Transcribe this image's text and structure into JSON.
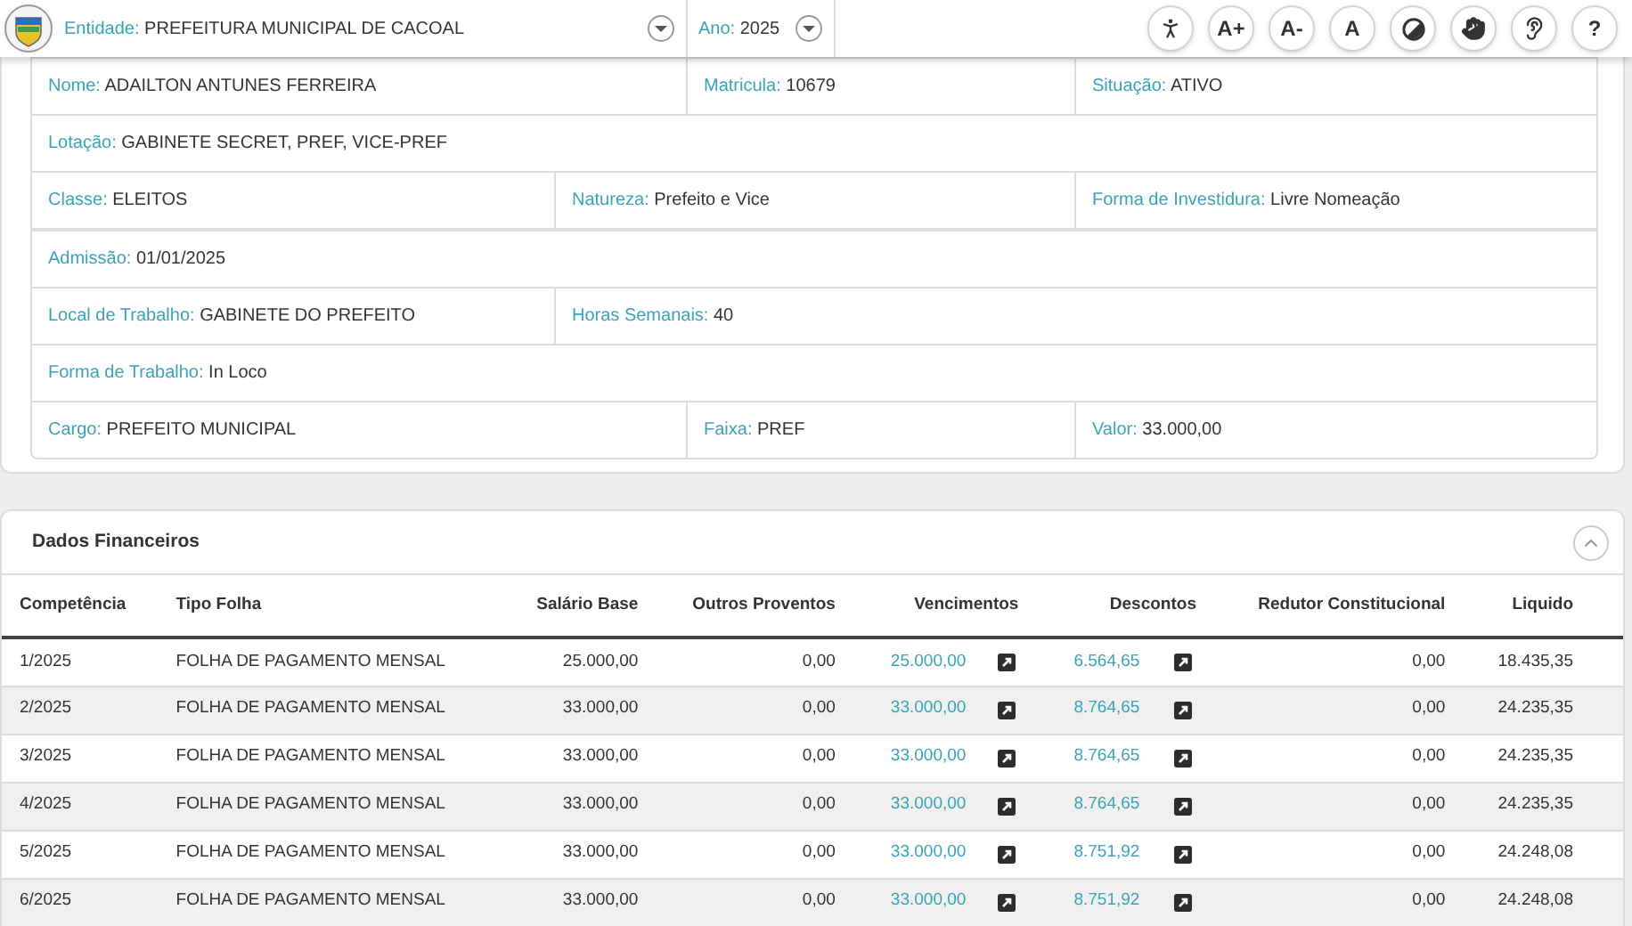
{
  "header": {
    "entity": {
      "label": "Entidade:",
      "value": "PREFEITURA MUNICIPAL DE CACOAL"
    },
    "year": {
      "label": "Ano:",
      "value": "2025"
    },
    "tools": [
      {
        "kind": "accessibility"
      },
      {
        "kind": "text",
        "label": "A+"
      },
      {
        "kind": "text",
        "label": "A-"
      },
      {
        "kind": "text",
        "label": "A"
      },
      {
        "kind": "contrast"
      },
      {
        "kind": "hand"
      },
      {
        "kind": "ear"
      },
      {
        "kind": "text",
        "label": "?"
      }
    ]
  },
  "details": {
    "rows": [
      {
        "kind": "wide",
        "fields": [
          {
            "label": "Nome:",
            "value": "ADAILTON ANTUNES FERREIRA"
          },
          {
            "label": "Matricula:",
            "value": "10679"
          },
          {
            "label": "Situação:",
            "value": "ATIVO"
          }
        ]
      },
      {
        "kind": "single",
        "fields": [
          {
            "label": "Lotação:",
            "value": "GABINETE SECRET, PREF, VICE-PREF"
          }
        ]
      },
      {
        "kind": "even",
        "fields": [
          {
            "label": "Classe:",
            "value": "ELEITOS"
          },
          {
            "label": "Natureza:",
            "value": "Prefeito e Vice"
          },
          {
            "label": "Forma de Investidura:",
            "value": "Livre Nomeação"
          }
        ]
      },
      {
        "kind": "single",
        "fields": [
          {
            "label": "Admissão:",
            "value": "01/01/2025"
          }
        ]
      },
      {
        "kind": "pair",
        "fields": [
          {
            "label": "Local de Trabalho:",
            "value": "GABINETE DO PREFEITO"
          },
          {
            "label": "Horas Semanais:",
            "value": "40"
          }
        ]
      },
      {
        "kind": "single",
        "fields": [
          {
            "label": "Forma de Trabalho:",
            "value": "In Loco"
          }
        ]
      },
      {
        "kind": "wide",
        "fields": [
          {
            "label": "Cargo:",
            "value": "PREFEITO MUNICIPAL"
          },
          {
            "label": "Faixa:",
            "value": "PREF"
          },
          {
            "label": "Valor:",
            "value": "33.000,00"
          }
        ]
      }
    ]
  },
  "financial": {
    "title": "Dados Financeiros",
    "expanded": true,
    "columns": [
      {
        "label": "Competência",
        "kind": "text"
      },
      {
        "label": "Tipo Folha",
        "kind": "text"
      },
      {
        "label": "Salário Base",
        "kind": "number"
      },
      {
        "label": "Outros Proventos",
        "kind": "number"
      },
      {
        "label": "Vencimentos",
        "kind": "link"
      },
      {
        "label": "Descontos",
        "kind": "link"
      },
      {
        "label": "Redutor Constitucional",
        "kind": "number"
      },
      {
        "label": "Liquido",
        "kind": "number"
      }
    ],
    "rows": [
      [
        "1/2025",
        "FOLHA DE PAGAMENTO MENSAL",
        "25.000,00",
        "0,00",
        "25.000,00",
        "6.564,65",
        "0,00",
        "18.435,35"
      ],
      [
        "2/2025",
        "FOLHA DE PAGAMENTO MENSAL",
        "33.000,00",
        "0,00",
        "33.000,00",
        "8.764,65",
        "0,00",
        "24.235,35"
      ],
      [
        "3/2025",
        "FOLHA DE PAGAMENTO MENSAL",
        "33.000,00",
        "0,00",
        "33.000,00",
        "8.764,65",
        "0,00",
        "24.235,35"
      ],
      [
        "4/2025",
        "FOLHA DE PAGAMENTO MENSAL",
        "33.000,00",
        "0,00",
        "33.000,00",
        "8.764,65",
        "0,00",
        "24.235,35"
      ],
      [
        "5/2025",
        "FOLHA DE PAGAMENTO MENSAL",
        "33.000,00",
        "0,00",
        "33.000,00",
        "8.751,92",
        "0,00",
        "24.248,08"
      ],
      [
        "6/2025",
        "FOLHA DE PAGAMENTO MENSAL",
        "33.000,00",
        "0,00",
        "33.000,00",
        "8.751,92",
        "0,00",
        "24.248,08"
      ]
    ]
  }
}
